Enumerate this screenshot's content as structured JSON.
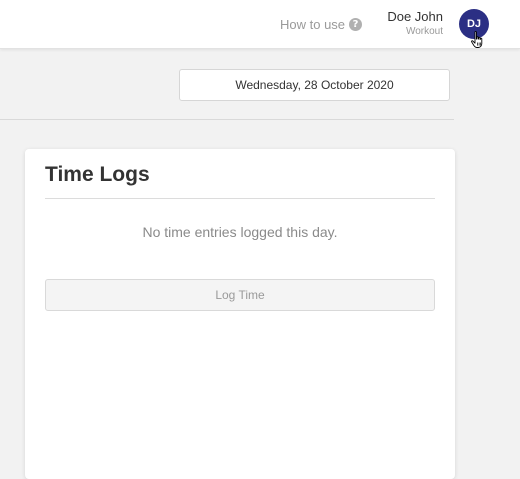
{
  "header": {
    "how_to_use": "How to use",
    "help_icon": "question-circle-icon",
    "user_name": "Doe John",
    "user_role": "Workout",
    "avatar_initials": "DJ",
    "avatar_color": "#2b2f84"
  },
  "date_picker": {
    "value": "Wednesday, 28 October 2020"
  },
  "time_logs": {
    "title": "Time Logs",
    "empty_message": "No time entries logged this day.",
    "log_button": "Log Time"
  }
}
